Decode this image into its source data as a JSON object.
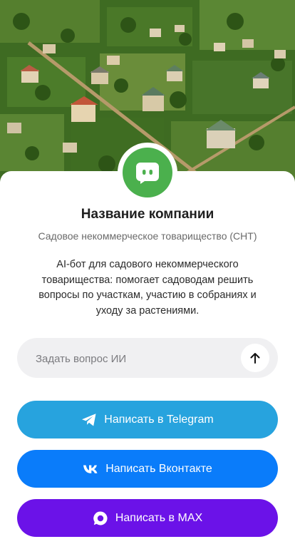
{
  "hero": {
    "image_alt": "Дачный посёлок"
  },
  "logo": {
    "icon": "chat-bot-icon"
  },
  "company": {
    "name": "Название компании",
    "subtitle": "Садовое некоммерческое товарищество (СНТ)",
    "description": "AI-бот для садового некоммерческого товарищества: помогает садоводам решить вопросы по участкам, участию в собраниях и уходу за растениями."
  },
  "ask": {
    "placeholder": "Задать вопрос ИИ",
    "value": "",
    "send_icon": "arrow-up-icon"
  },
  "buttons": {
    "telegram": {
      "label": "Написать в Telegram",
      "icon": "telegram-icon",
      "color": "#27a3de"
    },
    "vk": {
      "label": "Написать Вконтакте",
      "icon": "vk-icon",
      "color": "#0a7cfa"
    },
    "max": {
      "label": "Написать в MAX",
      "icon": "max-icon",
      "color": "#6b12e8"
    }
  },
  "colors": {
    "logo": "#4bb04d",
    "input_bg": "#f0f0f2"
  }
}
